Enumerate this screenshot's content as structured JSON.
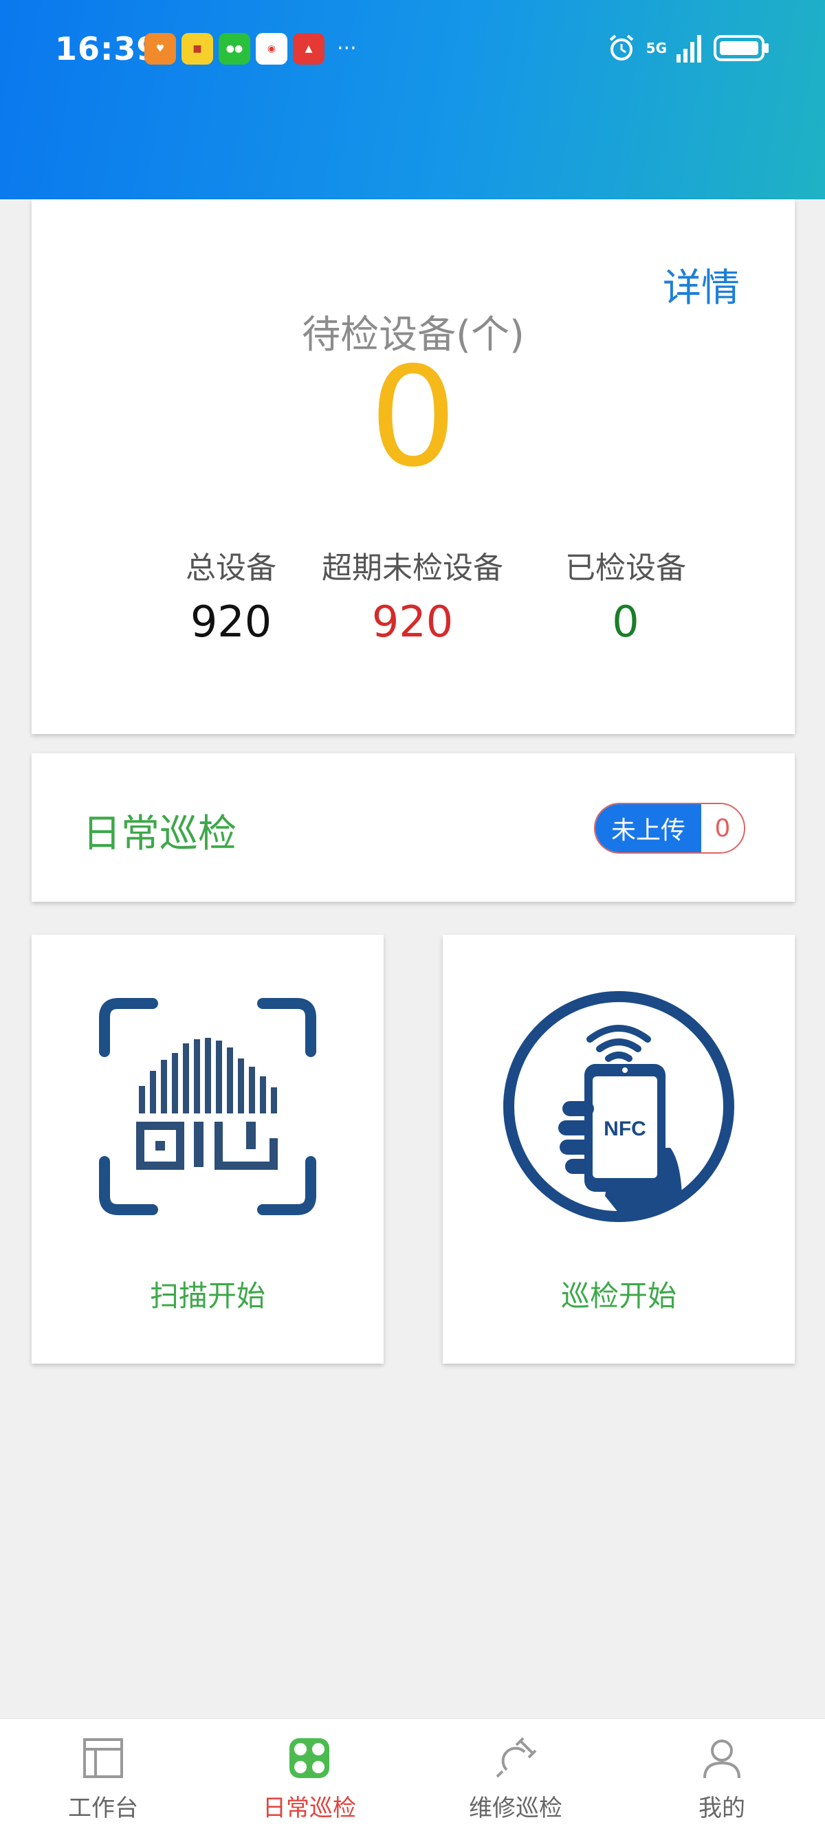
{
  "status_bar": {
    "time": "16:39",
    "network": "5G",
    "more": "···",
    "notif_icons": [
      "orange-heart-app-icon",
      "yellow-app-icon",
      "wechat-icon",
      "map-app-icon",
      "red-app-icon"
    ]
  },
  "summary": {
    "details_label": "详情",
    "pending_label": "待检设备(个)",
    "pending_value": "0",
    "stats": [
      {
        "label": "总设备",
        "value": "920",
        "color": "#111111"
      },
      {
        "label": "超期未检设备",
        "value": "920",
        "color": "#d52b2b"
      },
      {
        "label": "已检设备",
        "value": "0",
        "color": "#1a7f2a"
      }
    ]
  },
  "daily": {
    "title": "日常巡检",
    "upload_label": "未上传",
    "upload_count": "0"
  },
  "actions": {
    "scan_label": "扫描开始",
    "nfc_label": "巡检开始",
    "nfc_icon_text": "NFC"
  },
  "tabbar": {
    "items": [
      {
        "label": "工作台",
        "icon": "workbench-icon"
      },
      {
        "label": "日常巡检",
        "icon": "daily-inspection-icon",
        "active": true
      },
      {
        "label": "维修巡检",
        "icon": "repair-inspection-icon"
      },
      {
        "label": "我的",
        "icon": "profile-icon"
      }
    ]
  },
  "colors": {
    "accent_blue": "#1877e8",
    "green": "#3ea84a",
    "red": "#d52b2b",
    "yellow": "#f5b91a",
    "active_tab": "#e0443d"
  }
}
